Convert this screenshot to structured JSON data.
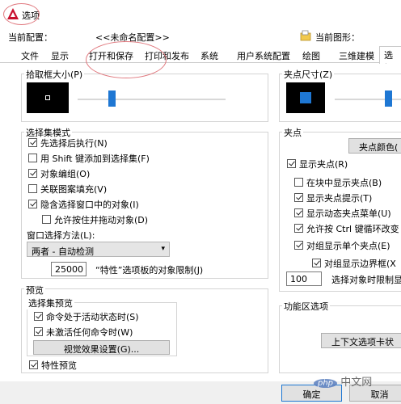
{
  "window": {
    "title": "选项"
  },
  "config": {
    "current_profile_label": "当前配置：",
    "current_profile_value": "<<未命名配置>>",
    "current_drawing_label": "当前图形："
  },
  "tabs": [
    "文件",
    "显示",
    "打开和保存",
    "打印和发布",
    "系统",
    "用户系统配置",
    "绘图",
    "三维建模",
    "选择"
  ],
  "left": {
    "pickbox": {
      "title": "拾取框大小(P)",
      "level": 0.22
    },
    "selection_modes": {
      "title": "选择集模式",
      "items": [
        {
          "label": "先选择后执行(N)",
          "checked": true
        },
        {
          "label": "用  Shift  键添加到选择集(F)",
          "checked": false
        },
        {
          "label": "对象编组(O)",
          "checked": true
        },
        {
          "label": "关联图案填充(V)",
          "checked": false
        },
        {
          "label": "隐含选择窗口中的对象(I)",
          "checked": true
        },
        {
          "label": "允许按住并拖动对象(D)",
          "checked": false
        }
      ],
      "window_method_label": "窗口选择方法(L):",
      "window_method_value": "两者 - 自动检测",
      "limit_value": "25000",
      "limit_label": "“特性”选项板的对象限制(J)"
    },
    "preview": {
      "title": "预览",
      "selection_preview_title": "选择集预览",
      "items": [
        {
          "label": "命令处于活动状态时(S)",
          "checked": true
        },
        {
          "label": "未激活任何命令时(W)",
          "checked": true
        }
      ],
      "visual_button": "视觉效果设置(G)...",
      "property_preview": {
        "label": "特性预览",
        "checked": true
      }
    }
  },
  "right": {
    "grip_size": {
      "title": "夹点尺寸(Z)",
      "level": 0.85
    },
    "grips": {
      "title": "夹点",
      "color_button": "夹点颜色(",
      "show_grips": {
        "label": "显示夹点(R)",
        "checked": true
      },
      "items": [
        {
          "label": "在块中显示夹点(B)",
          "checked": false
        },
        {
          "label": "显示夹点提示(T)",
          "checked": true
        },
        {
          "label": "显示动态夹点菜单(U)",
          "checked": true
        },
        {
          "label": "允许按 Ctrl 键循环改变",
          "checked": true
        },
        {
          "label": "对组显示单个夹点(E)",
          "checked": true
        }
      ],
      "bbox_item": {
        "label": "对组显示边界框(X",
        "checked": true
      },
      "limit_value": "100",
      "limit_label": "选择对象时限制显"
    },
    "ribbon": {
      "title": "功能区选项",
      "context_button": "上下文选项卡状"
    }
  },
  "footer": {
    "ok_button": "确定",
    "cancel_button": "取消"
  },
  "watermark": "php 中文网",
  "colors": {
    "accent": "#1e77d3",
    "app_icon_red": "#c8102e",
    "annotation_red": "#e0787e"
  }
}
